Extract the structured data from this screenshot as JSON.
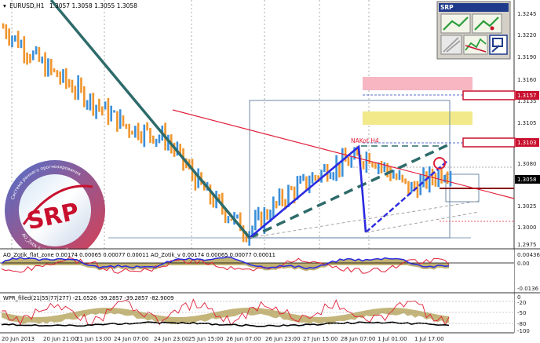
{
  "window": {
    "symbol_title": "EURUSD,H1",
    "ohlc": "1.3057 1.3058 1.3055 1.3058"
  },
  "main_panel": {
    "price_axis": [
      "1.3245",
      "1.3220",
      "1.3190",
      "1.3160",
      "1.3135",
      "1.3105",
      "1.3080",
      "1.3050",
      "1.3025",
      "1.3000",
      "1.2975"
    ],
    "current_price": "1.3058",
    "red_box_labels": [
      "1.3157",
      "1.3103"
    ],
    "annotation": "NAKot H4"
  },
  "srp_panel": {
    "title": "SRP"
  },
  "logo": {
    "letters": "SRP",
    "ring_text_top": "Система раннего прогнозирования",
    "ring_text_bottom": "AO_Zotik & WPR_v2mult"
  },
  "indicator_ao": {
    "title": "AO_Zotik_flat_zone 0.00174 0.00065 0.00077 0.00011   AO_Zotik_v 0.00174 0.00065 0.00077 0.00011",
    "axis": [
      "0.00436",
      "0.00",
      "-0.0136"
    ]
  },
  "indicator_wpr": {
    "title": "WPR_filled(21|55|77|277) -21.0526 -39.2857 -39.2857 -82.9009",
    "axis": [
      "0",
      "-20",
      "-50",
      "-80",
      "-100"
    ]
  },
  "time_axis": [
    "20 Jun 2013",
    "20 Jun 21:00",
    "21 Jun 13:00",
    "24 Jun 07:00",
    "24 Jun 23:00",
    "25 Jun 15:00",
    "26 Jun 07:00",
    "26 Jun 23:00",
    "27 Jun 15:00",
    "28 Jun 07:00",
    "1 Jul 01:00",
    "1 Jul 17:00"
  ],
  "chart_data": {
    "type": "bar",
    "title": "EURUSD,H1",
    "ylim": [
      1.297,
      1.325
    ],
    "x": [
      "20 Jun 2013",
      "20 Jun 21:00",
      "21 Jun 13:00",
      "24 Jun 07:00",
      "24 Jun 23:00",
      "25 Jun 15:00",
      "26 Jun 07:00",
      "26 Jun 23:00",
      "27 Jun 15:00",
      "28 Jun 07:00",
      "1 Jul 01:00",
      "1 Jul 17:00"
    ],
    "series": [
      {
        "values": [
          1.3225,
          1.318,
          1.3145,
          1.311,
          1.3095,
          1.303,
          1.2985,
          1.303,
          1.306,
          1.3075,
          1.3035,
          1.306
        ]
      }
    ],
    "grid": false,
    "colors": {
      "up": "#3b8fd9",
      "down": "#f0952d",
      "trend": "#2e6b6b",
      "channel": "#2a2ae0",
      "resistance": "#e0203a"
    }
  }
}
